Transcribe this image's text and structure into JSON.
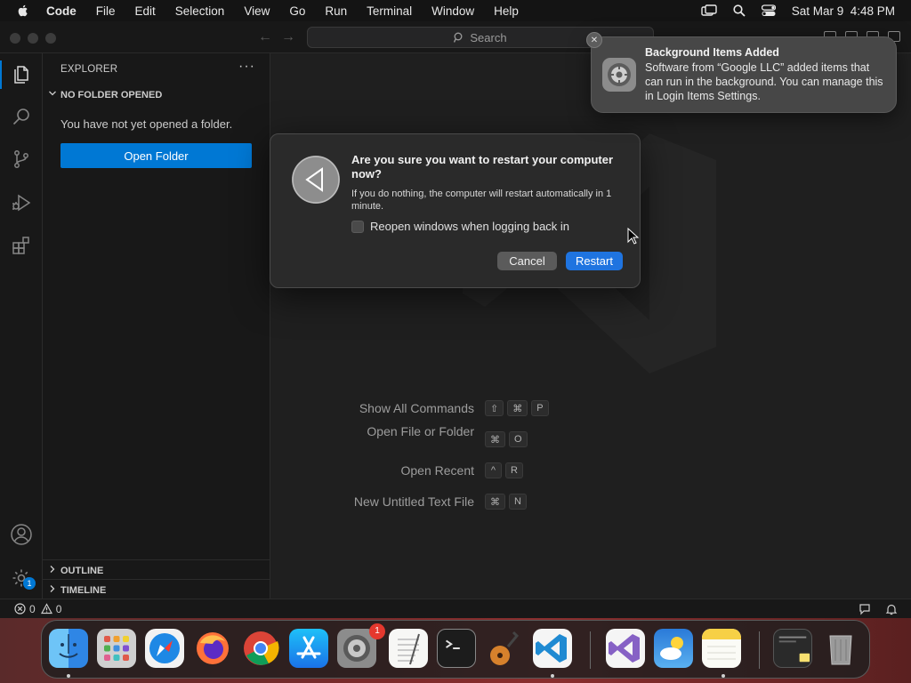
{
  "menubar": {
    "apple_icon": "apple-logo-icon",
    "items": [
      "Code",
      "File",
      "Edit",
      "Selection",
      "View",
      "Go",
      "Run",
      "Terminal",
      "Window",
      "Help"
    ],
    "clock": "Sat Mar 9  4:48 PM",
    "status_icons": [
      "display-icon",
      "spotlight-search-icon",
      "control-center-icon"
    ]
  },
  "titlebar": {
    "search_label": "Search"
  },
  "activity_bar": {
    "icons": [
      "explorer-icon",
      "search-icon",
      "source-control-icon",
      "run-debug-icon",
      "extensions-icon",
      "accounts-icon",
      "manage-gear-icon"
    ],
    "manage_badge": "1"
  },
  "sidebar": {
    "title": "EXPLORER",
    "more": "···",
    "section_header": "NO FOLDER OPENED",
    "message": "You have not yet opened a folder.",
    "open_folder_label": "Open Folder",
    "outline_label": "OUTLINE",
    "timeline_label": "TIMELINE"
  },
  "editor": {
    "shortcuts": [
      {
        "label": "Show All Commands",
        "keys": [
          "⇧",
          "⌘",
          "P"
        ]
      },
      {
        "label": "Open File or Folder",
        "keys": [
          "⌘",
          "O"
        ]
      },
      {
        "label": "Open Recent",
        "keys": [
          "^",
          "R"
        ]
      },
      {
        "label": "New Untitled Text File",
        "keys": [
          "⌘",
          "N"
        ]
      }
    ]
  },
  "statusbar": {
    "errors": "0",
    "warnings": "0"
  },
  "dialog": {
    "title": "Are you sure you want to restart your computer now?",
    "message": "If you do nothing, the computer will restart automatically in 1 minute.",
    "checkbox_label": "Reopen windows when logging back in",
    "checkbox_checked": false,
    "cancel_label": "Cancel",
    "restart_label": "Restart"
  },
  "notification": {
    "title": "Background Items Added",
    "body": "Software from “Google LLC” added items that can run in the background. You can manage this in Login Items Settings.",
    "close_glyph": "✕"
  },
  "dock": {
    "apps": [
      "Finder",
      "Launchpad",
      "Safari",
      "Firefox",
      "Google Chrome",
      "App Store",
      "System Settings",
      "TextEdit",
      "Terminal",
      "GarageBand",
      "Visual Studio Code",
      "Visual Studio",
      "Weather",
      "Notes",
      "Downloads Stack",
      "Trash"
    ],
    "system_settings_badge": "1"
  },
  "colors": {
    "accent": "#0078d4",
    "restart_button": "#1f74e0",
    "dock_badge": "#e5382e"
  }
}
